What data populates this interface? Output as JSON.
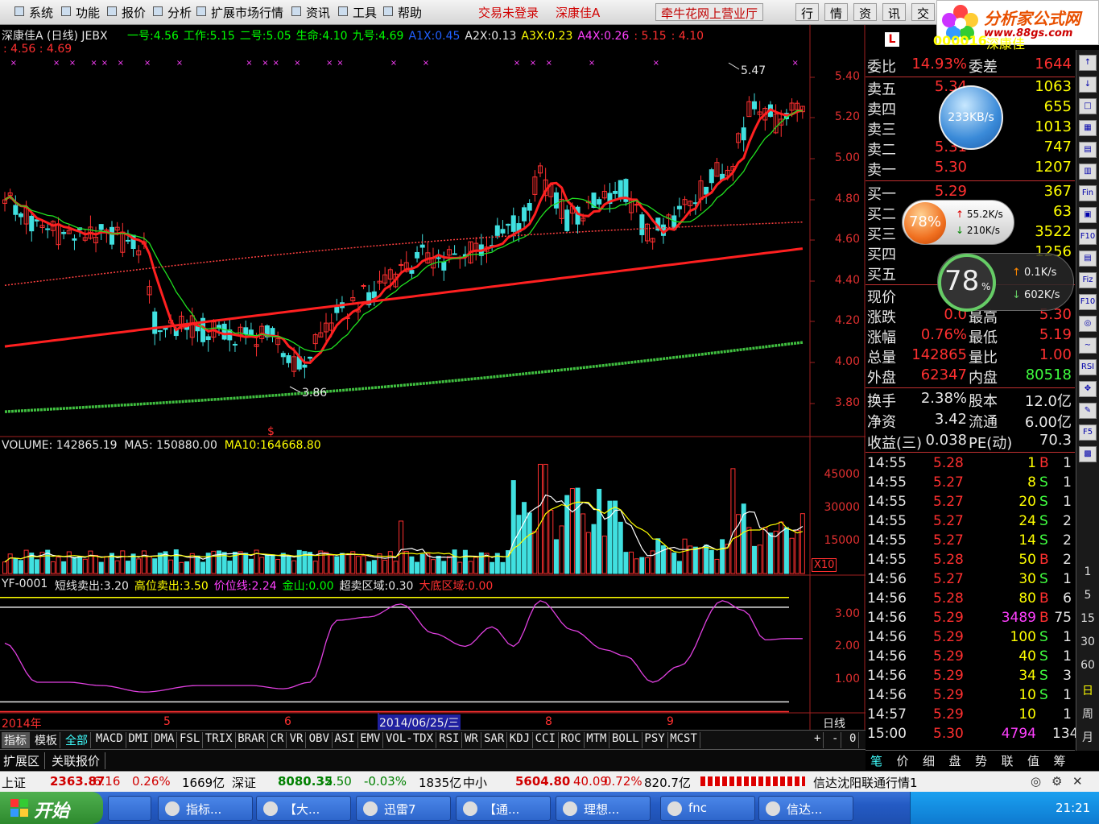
{
  "menu": {
    "items": [
      "系统",
      "功能",
      "报价",
      "分析",
      "扩展市场行情",
      "资讯",
      "工具",
      "帮助"
    ],
    "status1": "交易未登录",
    "status2": "深康佳A",
    "broker": "牵牛花网上营业厅",
    "tabs": [
      "行",
      "情",
      "资",
      "讯",
      "交"
    ]
  },
  "logo": {
    "title": "分析家公式网",
    "url": "www.88gs.com"
  },
  "kline": {
    "title": "深康佳A (日线) JEBX",
    "params": [
      {
        "label": "一号:",
        "value": "4.56",
        "color": "#00ff00"
      },
      {
        "label": "工作:",
        "value": "5.15",
        "color": "#00ff00"
      },
      {
        "label": "二号:",
        "value": "5.05",
        "color": "#00ff00"
      },
      {
        "label": "生命:",
        "value": "4.10",
        "color": "#00ff00"
      },
      {
        "label": "九号:",
        "value": "4.69",
        "color": "#00ff00"
      },
      {
        "label": "A1X:",
        "value": "0.45",
        "color": "#2060ff"
      },
      {
        "label": "A2X:",
        "value": "0.13",
        "color": "#e6e6e6"
      },
      {
        "label": "A3X:",
        "value": "0.23",
        "color": "#ffff00"
      },
      {
        "label": "A4X:",
        "value": "0.26",
        "color": "#ff40ff"
      }
    ],
    "extra1": ": 5.15",
    "extra2": ": 4.10",
    "line2": ": 4.56 : 4.69",
    "high_label": "5.47",
    "low_label": "3.86",
    "s_mark": "$",
    "yaxis": [
      "5.40",
      "5.20",
      "5.00",
      "4.80",
      "4.60",
      "4.40",
      "4.20",
      "4.00",
      "3.80"
    ]
  },
  "volume": {
    "label": "VOLUME:",
    "value": "142865.19",
    "ma5_label": "MA5:",
    "ma5": "150880.00",
    "ma10_label": "MA10:",
    "ma10": "164668.80",
    "yaxis": [
      "45000",
      "30000",
      "15000"
    ],
    "unit": "X10"
  },
  "indicator": {
    "name": "YF-0001",
    "items": [
      {
        "label": "短线卖出:",
        "value": "3.20",
        "color": "#e6e6e6"
      },
      {
        "label": "高位卖出:",
        "value": "3.50",
        "color": "#ffff00"
      },
      {
        "label": "价位线:",
        "value": "2.24",
        "color": "#ff40ff"
      },
      {
        "label": "金山:",
        "value": "0.00",
        "color": "#00ff00"
      },
      {
        "label": "超卖区域:",
        "value": "0.30",
        "color": "#e6e6e6"
      },
      {
        "label": "大底区域:",
        "value": "0.00",
        "color": "#ff3030"
      }
    ],
    "yaxis": [
      "3.00",
      "2.00",
      "1.00"
    ]
  },
  "timeaxis": {
    "labels": [
      "2014年",
      "5",
      "6",
      "2014/06/25/三",
      "8",
      "9"
    ],
    "period": "日线"
  },
  "quote": {
    "code": "000016",
    "name": "深康佳",
    "weibi_label": "委比",
    "weibi": "14.93%",
    "weicha_label": "委差",
    "weicha": "1644",
    "sell": [
      {
        "l": "卖五",
        "p": "5.34",
        "v": "1063"
      },
      {
        "l": "卖四",
        "p": "5",
        "v": "655"
      },
      {
        "l": "卖三",
        "p": "5",
        "v": "1013"
      },
      {
        "l": "卖二",
        "p": "5.31",
        "v": "747"
      },
      {
        "l": "卖一",
        "p": "5.30",
        "v": "1207"
      }
    ],
    "buy": [
      {
        "l": "买一",
        "p": "5.29",
        "v": "367"
      },
      {
        "l": "买二",
        "p": "",
        "v": "63"
      },
      {
        "l": "买三",
        "p": "",
        "v": "3522"
      },
      {
        "l": "买四",
        "p": "",
        "v": "1256"
      },
      {
        "l": "买五",
        "p": "",
        "v": ""
      }
    ],
    "stats": [
      {
        "k": "现价",
        "v": "",
        "k2": "",
        "v2": ""
      },
      {
        "k": "涨跌",
        "v": "0.0",
        "k2": "最高",
        "v2": "5.30"
      },
      {
        "k": "涨幅",
        "v": "0.76%",
        "k2": "最低",
        "v2": "5.19"
      },
      {
        "k": "总量",
        "v": "142865",
        "k2": "量比",
        "v2": "1.00"
      },
      {
        "k": "外盘",
        "v": "62347",
        "k2": "内盘",
        "v2": "80518"
      }
    ],
    "stats2": [
      {
        "k": "换手",
        "v": "2.38%",
        "k2": "股本",
        "v2": "12.0亿"
      },
      {
        "k": "净资",
        "v": "3.42",
        "k2": "流通",
        "v2": "6.00亿"
      },
      {
        "k": "收益(三)",
        "v": "0.038",
        "k2": "PE(动)",
        "v2": "70.3"
      }
    ],
    "ticks": [
      {
        "t": "14:55",
        "p": "5.28",
        "v": "1",
        "d": "B",
        "n": "1"
      },
      {
        "t": "14:55",
        "p": "5.27",
        "v": "8",
        "d": "S",
        "n": "1"
      },
      {
        "t": "14:55",
        "p": "5.27",
        "v": "20",
        "d": "S",
        "n": "1"
      },
      {
        "t": "14:55",
        "p": "5.27",
        "v": "24",
        "d": "S",
        "n": "2"
      },
      {
        "t": "14:55",
        "p": "5.27",
        "v": "14",
        "d": "S",
        "n": "2"
      },
      {
        "t": "14:55",
        "p": "5.28",
        "v": "50",
        "d": "B",
        "n": "2"
      },
      {
        "t": "14:56",
        "p": "5.27",
        "v": "30",
        "d": "S",
        "n": "1"
      },
      {
        "t": "14:56",
        "p": "5.28",
        "v": "80",
        "d": "B",
        "n": "6"
      },
      {
        "t": "14:56",
        "p": "5.29",
        "v": "3489",
        "d": "B",
        "n": "75"
      },
      {
        "t": "14:56",
        "p": "5.29",
        "v": "100",
        "d": "S",
        "n": "1"
      },
      {
        "t": "14:56",
        "p": "5.29",
        "v": "40",
        "d": "S",
        "n": "1"
      },
      {
        "t": "14:56",
        "p": "5.29",
        "v": "34",
        "d": "S",
        "n": "3"
      },
      {
        "t": "14:56",
        "p": "5.29",
        "v": "10",
        "d": "S",
        "n": "1"
      },
      {
        "t": "14:57",
        "p": "5.29",
        "v": "10",
        "d": "",
        "n": "1"
      },
      {
        "t": "15:00",
        "p": "5.30",
        "v": "4794",
        "d": "",
        "n": "134"
      }
    ],
    "bottom_tabs": [
      "笔",
      "价",
      "细",
      "盘",
      "势",
      "联",
      "值",
      "筹"
    ]
  },
  "widgets": {
    "speed1": "233KB/s",
    "pct1": "78%",
    "up1": "55.2K/s",
    "down1": "210K/s",
    "pct2": "78",
    "pct2_suffix": "%",
    "up2": "0.1K/s",
    "down2": "602K/s"
  },
  "rtools": [
    "↑",
    "↓",
    "□",
    "▦",
    "▤",
    "▥",
    "Fin",
    "▣",
    "F10",
    "▤",
    "Fiz",
    "F10",
    "◎",
    "∼",
    "RSI",
    "✥",
    "✎",
    "F5",
    "▩"
  ],
  "rnums": [
    "1",
    "5",
    "15",
    "30",
    "60",
    "日",
    "周",
    "月"
  ],
  "itabs": [
    "指标",
    "模板",
    "全部",
    "MACD",
    "DMI",
    "DMA",
    "FSL",
    "TRIX",
    "BRAR",
    "CR",
    "VR",
    "OBV",
    "ASI",
    "EMV",
    "VOL-TDX",
    "RSI",
    "WR",
    "SAR",
    "KDJ",
    "CCI",
    "ROC",
    "MTM",
    "BOLL",
    "PSY",
    "MCST"
  ],
  "itab_ctrl": [
    "+",
    "-",
    "0"
  ],
  "ext": [
    "扩展区",
    "关联报价"
  ],
  "status": [
    {
      "t": "上证",
      "c": "#000"
    },
    {
      "t": "2363.87",
      "c": "#d00000"
    },
    {
      "t": "6.16",
      "c": "#d00000"
    },
    {
      "t": "0.26%",
      "c": "#d00000"
    },
    {
      "t": "1669亿",
      "c": "#000"
    },
    {
      "t": "深证",
      "c": "#000"
    },
    {
      "t": "8080.35",
      "c": "#008000"
    },
    {
      "t": "-2.50",
      "c": "#008000"
    },
    {
      "t": "-0.03%",
      "c": "#008000"
    },
    {
      "t": "1835亿",
      "c": "#000"
    },
    {
      "t": "中小",
      "c": "#000"
    },
    {
      "t": "5604.80",
      "c": "#d00000"
    },
    {
      "t": "40.09",
      "c": "#d00000"
    },
    {
      "t": "0.72%",
      "c": "#d00000"
    },
    {
      "t": "820.7亿",
      "c": "#000"
    },
    {
      "t": "信达沈阳联通行情1",
      "c": "#000"
    }
  ],
  "taskbar": {
    "start": "开始",
    "buttons": [
      "指标...",
      "【大...",
      "迅雷7",
      "【通...",
      "理想...",
      "fnc",
      "信达..."
    ],
    "clock": "21:21"
  },
  "colors": {
    "up": "#ff3030",
    "down": "#40e0e0",
    "ma": "#ff2020",
    "ma2": "#20e020",
    "ma3": "#ff4040",
    "ma4": "#20c020"
  }
}
